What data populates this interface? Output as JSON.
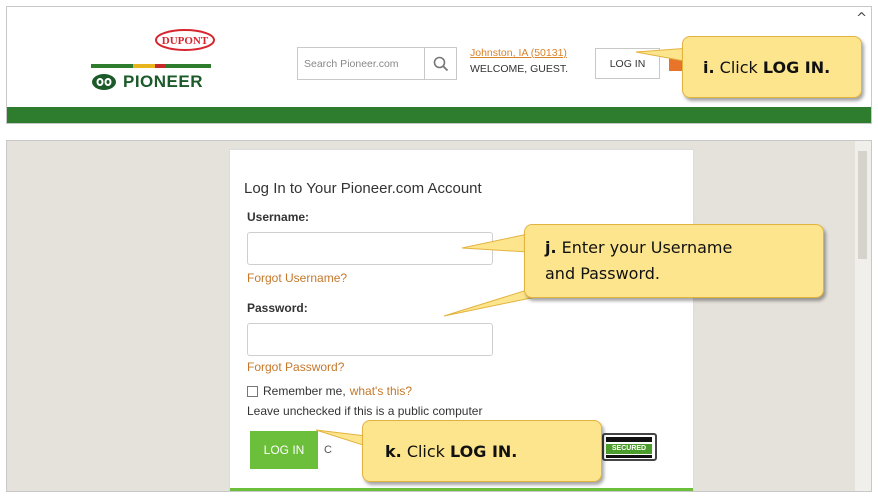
{
  "header": {
    "dupont_logo": "DUPONT",
    "brand": "PIONEER",
    "search_placeholder": "Search Pioneer.com",
    "location": "Johnston, IA (50131)",
    "welcome": "WELCOME, GUEST.",
    "login_label": "LOG IN"
  },
  "callouts": {
    "i": {
      "step": "i.",
      "text": "Click",
      "bold": "LOG IN."
    },
    "j": {
      "step": "j.",
      "line1": "Enter your Username",
      "line2": "and Password."
    },
    "k": {
      "step": "k.",
      "text": "Click",
      "bold": "LOG IN."
    }
  },
  "login_form": {
    "title": "Log In to Your Pioneer.com Account",
    "username_label": "Username:",
    "forgot_username": "Forgot Username?",
    "password_label": "Password:",
    "forgot_password": "Forgot Password?",
    "remember_label": "Remember me,",
    "whats_this": "what's this?",
    "hint": "Leave unchecked if this is a public computer",
    "login_button": "LOG IN",
    "badge_text": "SECURED"
  },
  "colors": {
    "brand_green": "#2e7d2e",
    "button_green": "#6cbf3a",
    "link_orange": "#c5782b",
    "callout_fill": "#fde58d",
    "dupont_red": "#d7262e"
  }
}
